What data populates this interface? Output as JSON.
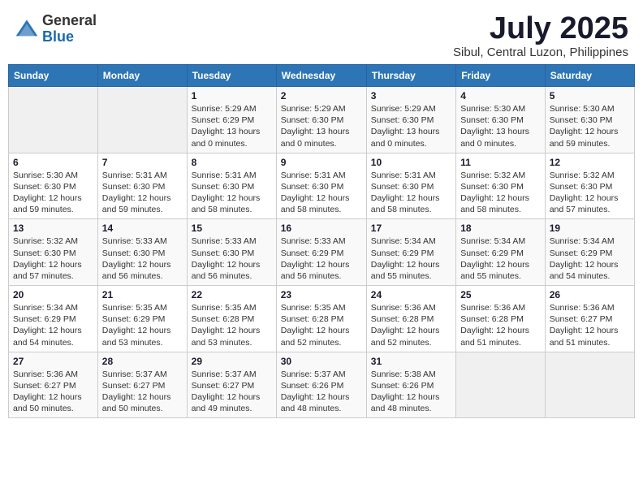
{
  "header": {
    "logo_general": "General",
    "logo_blue": "Blue",
    "title": "July 2025",
    "location": "Sibul, Central Luzon, Philippines"
  },
  "weekdays": [
    "Sunday",
    "Monday",
    "Tuesday",
    "Wednesday",
    "Thursday",
    "Friday",
    "Saturday"
  ],
  "weeks": [
    [
      {
        "day": "",
        "sunrise": "",
        "sunset": "",
        "daylight": "",
        "empty": true
      },
      {
        "day": "",
        "sunrise": "",
        "sunset": "",
        "daylight": "",
        "empty": true
      },
      {
        "day": "1",
        "sunrise": "Sunrise: 5:29 AM",
        "sunset": "Sunset: 6:29 PM",
        "daylight": "Daylight: 13 hours and 0 minutes."
      },
      {
        "day": "2",
        "sunrise": "Sunrise: 5:29 AM",
        "sunset": "Sunset: 6:30 PM",
        "daylight": "Daylight: 13 hours and 0 minutes."
      },
      {
        "day": "3",
        "sunrise": "Sunrise: 5:29 AM",
        "sunset": "Sunset: 6:30 PM",
        "daylight": "Daylight: 13 hours and 0 minutes."
      },
      {
        "day": "4",
        "sunrise": "Sunrise: 5:30 AM",
        "sunset": "Sunset: 6:30 PM",
        "daylight": "Daylight: 13 hours and 0 minutes."
      },
      {
        "day": "5",
        "sunrise": "Sunrise: 5:30 AM",
        "sunset": "Sunset: 6:30 PM",
        "daylight": "Daylight: 12 hours and 59 minutes."
      }
    ],
    [
      {
        "day": "6",
        "sunrise": "Sunrise: 5:30 AM",
        "sunset": "Sunset: 6:30 PM",
        "daylight": "Daylight: 12 hours and 59 minutes."
      },
      {
        "day": "7",
        "sunrise": "Sunrise: 5:31 AM",
        "sunset": "Sunset: 6:30 PM",
        "daylight": "Daylight: 12 hours and 59 minutes."
      },
      {
        "day": "8",
        "sunrise": "Sunrise: 5:31 AM",
        "sunset": "Sunset: 6:30 PM",
        "daylight": "Daylight: 12 hours and 58 minutes."
      },
      {
        "day": "9",
        "sunrise": "Sunrise: 5:31 AM",
        "sunset": "Sunset: 6:30 PM",
        "daylight": "Daylight: 12 hours and 58 minutes."
      },
      {
        "day": "10",
        "sunrise": "Sunrise: 5:31 AM",
        "sunset": "Sunset: 6:30 PM",
        "daylight": "Daylight: 12 hours and 58 minutes."
      },
      {
        "day": "11",
        "sunrise": "Sunrise: 5:32 AM",
        "sunset": "Sunset: 6:30 PM",
        "daylight": "Daylight: 12 hours and 58 minutes."
      },
      {
        "day": "12",
        "sunrise": "Sunrise: 5:32 AM",
        "sunset": "Sunset: 6:30 PM",
        "daylight": "Daylight: 12 hours and 57 minutes."
      }
    ],
    [
      {
        "day": "13",
        "sunrise": "Sunrise: 5:32 AM",
        "sunset": "Sunset: 6:30 PM",
        "daylight": "Daylight: 12 hours and 57 minutes."
      },
      {
        "day": "14",
        "sunrise": "Sunrise: 5:33 AM",
        "sunset": "Sunset: 6:30 PM",
        "daylight": "Daylight: 12 hours and 56 minutes."
      },
      {
        "day": "15",
        "sunrise": "Sunrise: 5:33 AM",
        "sunset": "Sunset: 6:30 PM",
        "daylight": "Daylight: 12 hours and 56 minutes."
      },
      {
        "day": "16",
        "sunrise": "Sunrise: 5:33 AM",
        "sunset": "Sunset: 6:29 PM",
        "daylight": "Daylight: 12 hours and 56 minutes."
      },
      {
        "day": "17",
        "sunrise": "Sunrise: 5:34 AM",
        "sunset": "Sunset: 6:29 PM",
        "daylight": "Daylight: 12 hours and 55 minutes."
      },
      {
        "day": "18",
        "sunrise": "Sunrise: 5:34 AM",
        "sunset": "Sunset: 6:29 PM",
        "daylight": "Daylight: 12 hours and 55 minutes."
      },
      {
        "day": "19",
        "sunrise": "Sunrise: 5:34 AM",
        "sunset": "Sunset: 6:29 PM",
        "daylight": "Daylight: 12 hours and 54 minutes."
      }
    ],
    [
      {
        "day": "20",
        "sunrise": "Sunrise: 5:34 AM",
        "sunset": "Sunset: 6:29 PM",
        "daylight": "Daylight: 12 hours and 54 minutes."
      },
      {
        "day": "21",
        "sunrise": "Sunrise: 5:35 AM",
        "sunset": "Sunset: 6:29 PM",
        "daylight": "Daylight: 12 hours and 53 minutes."
      },
      {
        "day": "22",
        "sunrise": "Sunrise: 5:35 AM",
        "sunset": "Sunset: 6:28 PM",
        "daylight": "Daylight: 12 hours and 53 minutes."
      },
      {
        "day": "23",
        "sunrise": "Sunrise: 5:35 AM",
        "sunset": "Sunset: 6:28 PM",
        "daylight": "Daylight: 12 hours and 52 minutes."
      },
      {
        "day": "24",
        "sunrise": "Sunrise: 5:36 AM",
        "sunset": "Sunset: 6:28 PM",
        "daylight": "Daylight: 12 hours and 52 minutes."
      },
      {
        "day": "25",
        "sunrise": "Sunrise: 5:36 AM",
        "sunset": "Sunset: 6:28 PM",
        "daylight": "Daylight: 12 hours and 51 minutes."
      },
      {
        "day": "26",
        "sunrise": "Sunrise: 5:36 AM",
        "sunset": "Sunset: 6:27 PM",
        "daylight": "Daylight: 12 hours and 51 minutes."
      }
    ],
    [
      {
        "day": "27",
        "sunrise": "Sunrise: 5:36 AM",
        "sunset": "Sunset: 6:27 PM",
        "daylight": "Daylight: 12 hours and 50 minutes."
      },
      {
        "day": "28",
        "sunrise": "Sunrise: 5:37 AM",
        "sunset": "Sunset: 6:27 PM",
        "daylight": "Daylight: 12 hours and 50 minutes."
      },
      {
        "day": "29",
        "sunrise": "Sunrise: 5:37 AM",
        "sunset": "Sunset: 6:27 PM",
        "daylight": "Daylight: 12 hours and 49 minutes."
      },
      {
        "day": "30",
        "sunrise": "Sunrise: 5:37 AM",
        "sunset": "Sunset: 6:26 PM",
        "daylight": "Daylight: 12 hours and 48 minutes."
      },
      {
        "day": "31",
        "sunrise": "Sunrise: 5:38 AM",
        "sunset": "Sunset: 6:26 PM",
        "daylight": "Daylight: 12 hours and 48 minutes."
      },
      {
        "day": "",
        "sunrise": "",
        "sunset": "",
        "daylight": "",
        "empty": true
      },
      {
        "day": "",
        "sunrise": "",
        "sunset": "",
        "daylight": "",
        "empty": true
      }
    ]
  ]
}
